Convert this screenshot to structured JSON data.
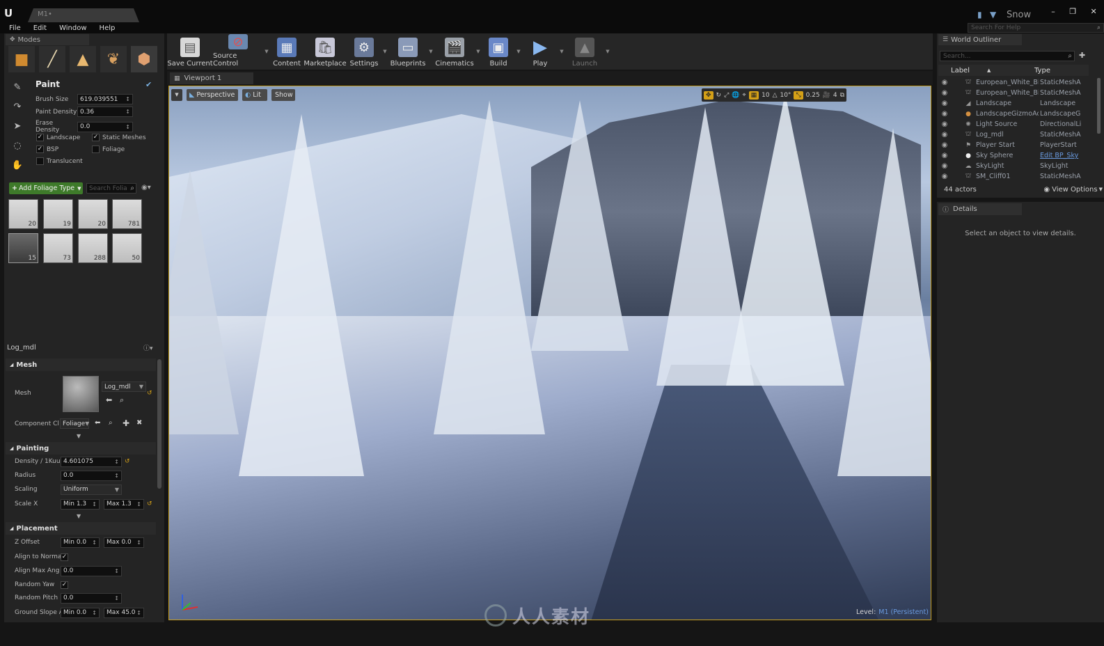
{
  "titlebar": {
    "tab_title": "M1•",
    "project_name": "Snow",
    "help_search_placeholder": "Search For Help"
  },
  "menu": [
    "File",
    "Edit",
    "Window",
    "Help"
  ],
  "modes_panel": {
    "tab_label": "Modes",
    "paint": {
      "title": "Paint",
      "brush_size_label": "Brush Size",
      "brush_size_value": "619.039551",
      "paint_density_label": "Paint Density",
      "paint_density_value": "0.36",
      "erase_density_label": "Erase Density",
      "erase_density_value": "0.0",
      "filters": [
        {
          "label": "Landscape",
          "checked": true
        },
        {
          "label": "Static Meshes",
          "checked": true
        },
        {
          "label": "BSP",
          "checked": true
        },
        {
          "label": "Foliage",
          "checked": false
        },
        {
          "label": "Translucent",
          "checked": false
        }
      ]
    },
    "add_foliage_label": "Add Foliage Type",
    "search_foliage_placeholder": "Search Folia",
    "foliage_counts": [
      "20",
      "19",
      "20",
      "781",
      "15",
      "73",
      "288",
      "50"
    ],
    "selected_mesh_name": "Log_mdl",
    "mesh_section": {
      "title": "Mesh",
      "mesh_label": "Mesh",
      "mesh_value": "Log_mdl",
      "component_label": "Component Cl",
      "component_value": "Foliage"
    },
    "painting_section": {
      "title": "Painting",
      "density_label": "Density / 1Kuu",
      "density_value": "4.601075",
      "radius_label": "Radius",
      "radius_value": "0.0",
      "scaling_label": "Scaling",
      "scaling_value": "Uniform",
      "scale_x_label": "Scale X",
      "scale_x_min": "Min  1.3",
      "scale_x_max": "Max  1.3"
    },
    "placement_section": {
      "title": "Placement",
      "z_offset_label": "Z Offset",
      "z_offset_min": "Min  0.0",
      "z_offset_max": "Max  0.0",
      "align_normal_label": "Align to Norma",
      "align_max_label": "Align Max Ang",
      "align_max_value": "0.0",
      "random_yaw_label": "Random Yaw",
      "random_pitch_label": "Random Pitch",
      "random_pitch_value": "0.0",
      "ground_slope_label": "Ground Slope A",
      "ground_slope_min": "Min  0.0",
      "ground_slope_max": "Max  45.0"
    }
  },
  "toolbar": [
    {
      "label": "Save Current",
      "icon": "save-icon"
    },
    {
      "label": "Source Control",
      "icon": "source-control-icon"
    },
    {
      "label": "Content",
      "icon": "content-icon"
    },
    {
      "label": "Marketplace",
      "icon": "marketplace-icon"
    },
    {
      "label": "Settings",
      "icon": "settings-icon"
    },
    {
      "label": "Blueprints",
      "icon": "blueprints-icon"
    },
    {
      "label": "Cinematics",
      "icon": "cinematics-icon"
    },
    {
      "label": "Build",
      "icon": "build-icon"
    },
    {
      "label": "Play",
      "icon": "play-icon"
    },
    {
      "label": "Launch",
      "icon": "launch-icon"
    }
  ],
  "viewport": {
    "tab_label": "Viewport 1",
    "perspective_label": "Perspective",
    "lit_label": "Lit",
    "show_label": "Show",
    "grid_snap": "10",
    "rotation_snap": "10°",
    "scale_snap": "0.25",
    "camera_speed": "4",
    "level_label": "Level:",
    "level_name": "M1 (Persistent)"
  },
  "world_outliner": {
    "tab_label": "World Outliner",
    "search_placeholder": "Search...",
    "col_label": "Label",
    "col_type": "Type",
    "rows": [
      {
        "label": "European_White_Birch",
        "type": "StaticMeshA"
      },
      {
        "label": "European_White_Birch",
        "type": "StaticMeshA"
      },
      {
        "label": "Landscape",
        "type": "Landscape"
      },
      {
        "label": "LandscapeGizmoActi",
        "type": "LandscapeG"
      },
      {
        "label": "Light Source",
        "type": "DirectionalLi"
      },
      {
        "label": "Log_mdl",
        "type": "StaticMeshA"
      },
      {
        "label": "Player Start",
        "type": "PlayerStart"
      },
      {
        "label": "Sky Sphere",
        "type": "Edit BP_Sky"
      },
      {
        "label": "SkyLight",
        "type": "SkyLight"
      },
      {
        "label": "SM_Cliff01",
        "type": "StaticMeshA"
      }
    ],
    "actor_count": "44 actors",
    "view_options": "View Options"
  },
  "details": {
    "tab_label": "Details",
    "empty_message": "Select an object to view details."
  },
  "watermark": "人人素材",
  "colors": {
    "accent_orange": "#d4a017",
    "link_blue": "#6a9be0",
    "panel_bg": "#242424"
  }
}
